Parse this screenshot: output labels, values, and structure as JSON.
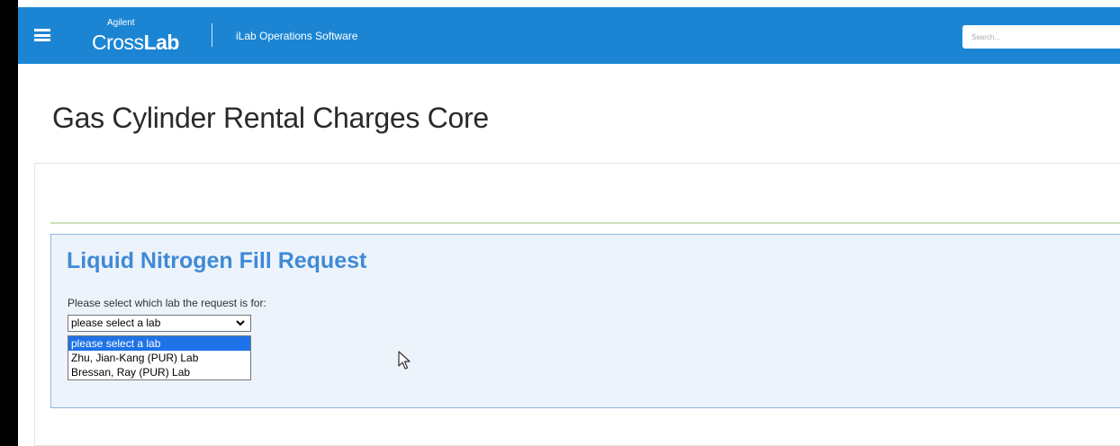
{
  "navbar": {
    "logo_small": "Agilent",
    "logo_cross": "Cross",
    "logo_lab": "Lab",
    "product": "iLab Operations Software",
    "search_placeholder": "Search...",
    "color": "#1b85d4"
  },
  "page": {
    "title": "Gas Cylinder Rental Charges Core"
  },
  "form": {
    "title": "Liquid Nitrogen Fill Request",
    "prompt": "Please select which lab the request is for:",
    "selected_value": "please select a lab",
    "options": [
      "please select a lab",
      "Zhu, Jian-Kang (PUR) Lab",
      "Bressan, Ray (PUR) Lab"
    ],
    "accent": "#3f8ad6"
  }
}
